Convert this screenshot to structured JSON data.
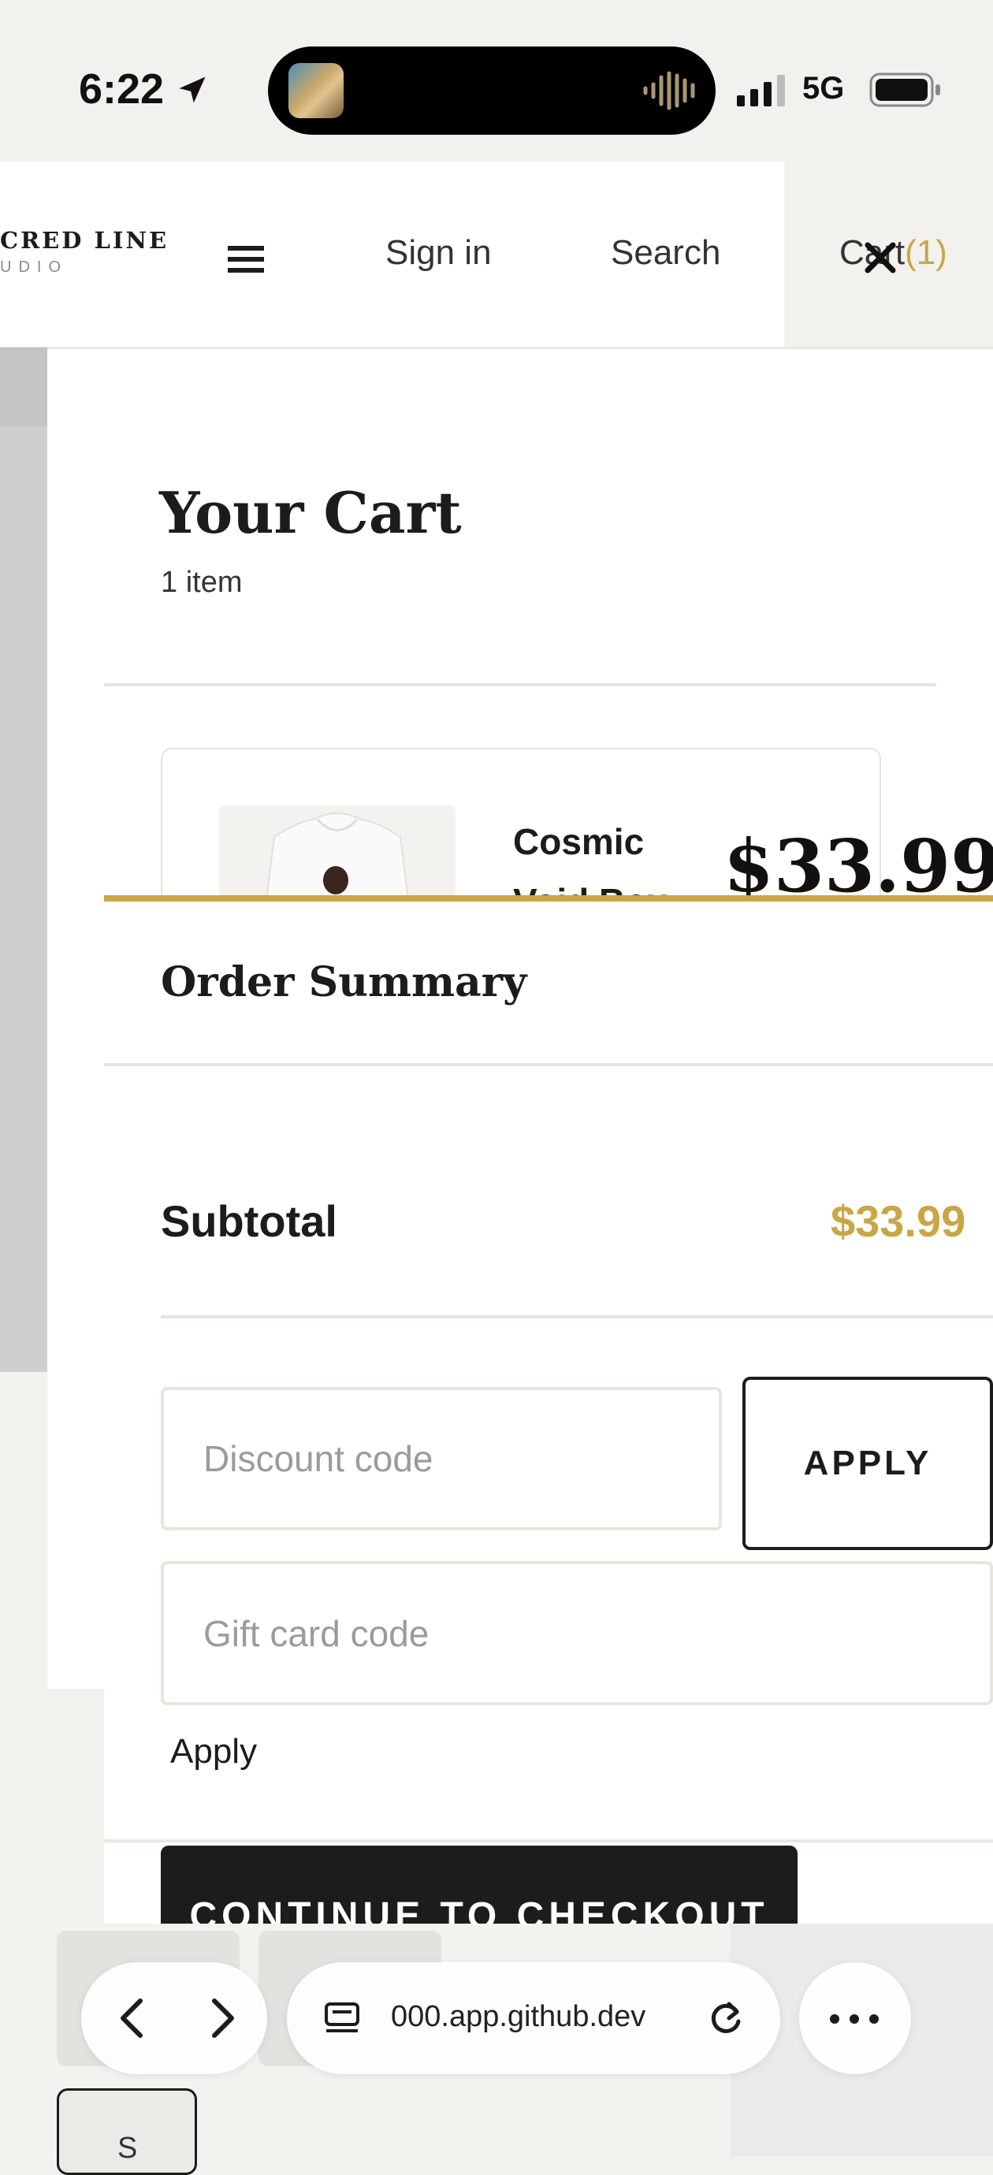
{
  "status_bar": {
    "time": "6:22",
    "network": "5G"
  },
  "store": {
    "logo_line1": "CRED LINE",
    "logo_line2": "UDIO",
    "nav": {
      "signin": "Sign in",
      "search": "Search",
      "cart_label": "Cart",
      "cart_count": "(1)"
    }
  },
  "cart": {
    "title": "Your Cart",
    "item_count": "1 item",
    "items": [
      {
        "name": "Cosmic Void Box",
        "price": "$33.99"
      }
    ]
  },
  "summary": {
    "title": "Order Summary",
    "subtotal_label": "Subtotal",
    "subtotal_value": "$33.99",
    "discount_placeholder": "Discount code",
    "apply_label": "APPLY",
    "giftcard_placeholder": "Gift card code",
    "giftcard_apply_label": "Apply",
    "checkout_label": "CONTINUE TO CHECKOUT"
  },
  "browser": {
    "url": "000.app.github.dev",
    "tab_strip_label": "S"
  },
  "colors": {
    "accent": "#c9a646",
    "dark": "#1c1c1c",
    "divider": "#e5e4dc"
  }
}
